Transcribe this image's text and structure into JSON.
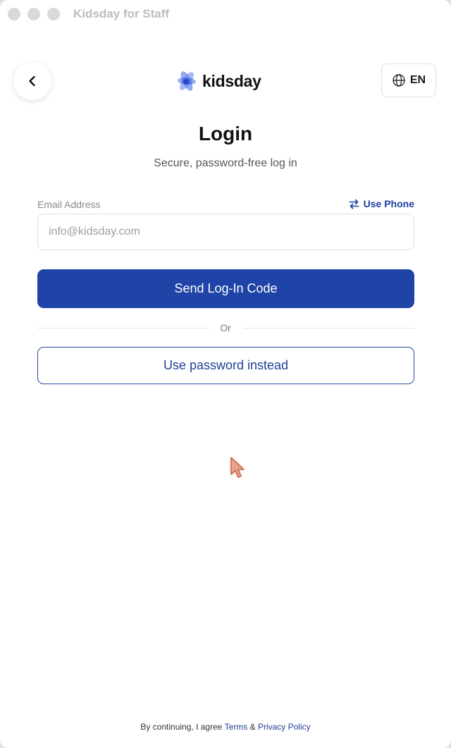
{
  "window": {
    "title": "Kidsday for Staff"
  },
  "header": {
    "logo_text": "kidsday",
    "language": "EN",
    "back_icon": "chevron-left-icon",
    "language_icon": "globe-icon"
  },
  "main": {
    "title": "Login",
    "subtitle": "Secure, password-free log in",
    "email_label": "Email Address",
    "email_placeholder": "info@kidsday.com",
    "email_value": "",
    "use_phone_label": "Use Phone",
    "use_phone_icon": "swap-arrows-icon",
    "send_code_label": "Send Log-In Code",
    "divider_text": "Or",
    "use_password_label": "Use password instead"
  },
  "footer": {
    "prefix": "By continuing, I agree",
    "terms_label": "Terms",
    "ampersand": "&",
    "privacy_label": "Privacy Policy"
  },
  "colors": {
    "primary": "#1f43a6",
    "link": "#1f3f95",
    "logo_accent": "#3d63e8"
  }
}
